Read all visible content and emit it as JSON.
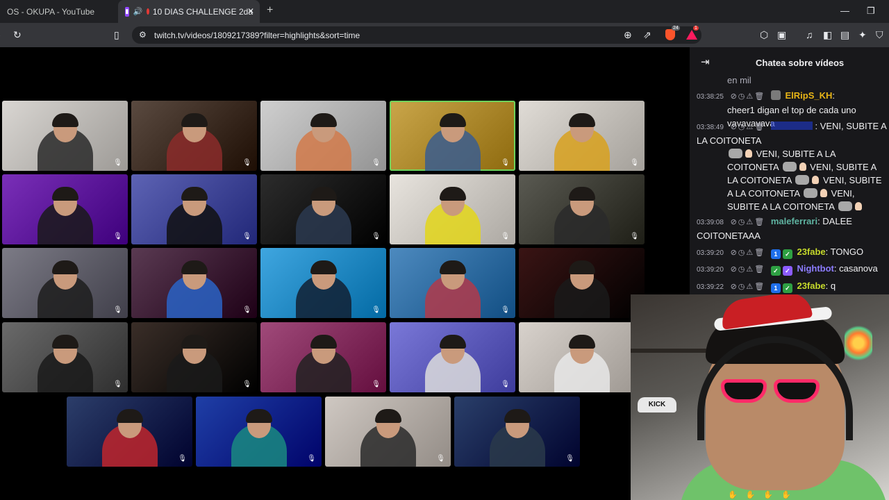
{
  "browser": {
    "tabs": [
      {
        "label": "OS - OKUPA - YouTube",
        "active": false
      },
      {
        "label": "10 DIAS CHALLENGE 2da",
        "active": true
      }
    ],
    "url": "twitch.tv/videos/1809217389?filter=highlights&sort=time",
    "shield_count": "24",
    "alert_count": "1",
    "new_tab_label": "+"
  },
  "chat": {
    "title": "Chatea sobre vídeos",
    "cut_text": "en mil",
    "messages": [
      {
        "time": "03:38:25",
        "user": "ElRipS_KH",
        "user_color": "#e7b416",
        "text": "cheer1 digan el top de cada uno vavavavava"
      },
      {
        "time": "03:38:49",
        "user": "",
        "user_color": "#1f3bd1",
        "text_parts": [
          ": VENI, SUBITE A LA COITONETA",
          "VENI, SUBITE A LA COITONETA",
          "VENI, SUBITE A LA COITONETA",
          "VENI, SUBITE A LA COITONETA",
          "VENI, SUBITE A LA",
          "COITONETA"
        ]
      },
      {
        "time": "03:39:08",
        "user": "maleferrari",
        "user_color": "#5fb3a1",
        "text": ": DALEE COITONETAAA"
      },
      {
        "time": "03:39:20",
        "user": "23fabe",
        "user_color": "#c5d92b",
        "text": ": TONGO"
      },
      {
        "time": "03:39:20",
        "user": "Nightbot",
        "user_color": "#8c7cff",
        "text": ": casanova"
      },
      {
        "time": "03:39:22",
        "user": "23fabe",
        "user_color": "#c5d92b",
        "text": ": q"
      }
    ]
  },
  "webcam": {
    "hat_text": "KICK"
  },
  "icons": [
    "back-icon",
    "reload-icon",
    "bookmark-icon",
    "site-info-icon",
    "zoom-icon",
    "share-icon",
    "brave-shield-icon",
    "brave-rewards-icon",
    "extensions-icon",
    "media-icon",
    "sidebar-icon",
    "wallet-icon",
    "leo-icon",
    "vpn-icon",
    "collapse-chat-icon",
    "mic-muted-icon"
  ],
  "colors": {
    "twitch_purple": "#9146ff",
    "chat_bg": "#18181b",
    "speaking_outline": "#6fd35b"
  }
}
